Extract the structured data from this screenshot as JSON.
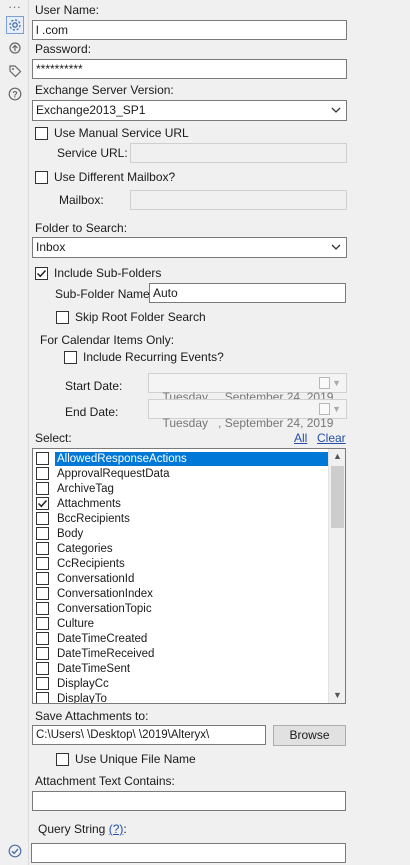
{
  "sidebar": {
    "dots": "...",
    "icons": [
      "gear-icon",
      "refresh-icon",
      "tag-icon",
      "help-icon",
      "check-icon"
    ]
  },
  "user_name": {
    "label": "User Name:",
    "value": "l                   .com"
  },
  "password": {
    "label": "Password:",
    "value": "**********"
  },
  "exchange_version": {
    "label": "Exchange Server Version:",
    "value": "Exchange2013_SP1"
  },
  "manual_url": {
    "label": "Use Manual Service URL",
    "checked": false,
    "field_label": "Service URL:",
    "value": ""
  },
  "different_mailbox": {
    "label": "Use Different Mailbox?",
    "checked": false,
    "field_label": "Mailbox:",
    "value": ""
  },
  "folder": {
    "label": "Folder to Search:",
    "value": "Inbox"
  },
  "subfolders": {
    "label": "Include Sub-Folders",
    "checked": true,
    "name_label": "Sub-Folder Name:",
    "name_value": "Auto",
    "skip_root_label": "Skip Root Folder Search",
    "skip_root_checked": false
  },
  "calendar": {
    "title": "For Calendar Items Only:",
    "recurring_label": "Include Recurring Events?",
    "recurring_checked": false,
    "start_label": "Start Date:",
    "start_value": "Tuesday   , September 24, 2019",
    "end_label": "End Date:",
    "end_value": "Tuesday   , September 24, 2019"
  },
  "select": {
    "label": "Select:",
    "all_link": "All",
    "clear_link": "Clear",
    "items": [
      {
        "label": "AllowedResponseActions",
        "checked": false,
        "selected": true
      },
      {
        "label": "ApprovalRequestData",
        "checked": false,
        "selected": false
      },
      {
        "label": "ArchiveTag",
        "checked": false,
        "selected": false
      },
      {
        "label": "Attachments",
        "checked": true,
        "selected": false
      },
      {
        "label": "BccRecipients",
        "checked": false,
        "selected": false
      },
      {
        "label": "Body",
        "checked": false,
        "selected": false
      },
      {
        "label": "Categories",
        "checked": false,
        "selected": false
      },
      {
        "label": "CcRecipients",
        "checked": false,
        "selected": false
      },
      {
        "label": "ConversationId",
        "checked": false,
        "selected": false
      },
      {
        "label": "ConversationIndex",
        "checked": false,
        "selected": false
      },
      {
        "label": "ConversationTopic",
        "checked": false,
        "selected": false
      },
      {
        "label": "Culture",
        "checked": false,
        "selected": false
      },
      {
        "label": "DateTimeCreated",
        "checked": false,
        "selected": false
      },
      {
        "label": "DateTimeReceived",
        "checked": false,
        "selected": false
      },
      {
        "label": "DateTimeSent",
        "checked": false,
        "selected": false
      },
      {
        "label": "DisplayCc",
        "checked": false,
        "selected": false
      },
      {
        "label": "DisplayTo",
        "checked": false,
        "selected": false
      }
    ]
  },
  "attachments": {
    "label": "Save Attachments to:",
    "path": "C:\\Users\\            \\Desktop\\        \\2019\\Alteryx\\",
    "browse_label": "Browse",
    "unique_label": "Use Unique File Name",
    "unique_checked": false,
    "text_label": "Attachment Text Contains:",
    "text_value": ""
  },
  "query": {
    "label": "Query String",
    "help_link": "(?)",
    "label_suffix": ":",
    "value": ""
  }
}
